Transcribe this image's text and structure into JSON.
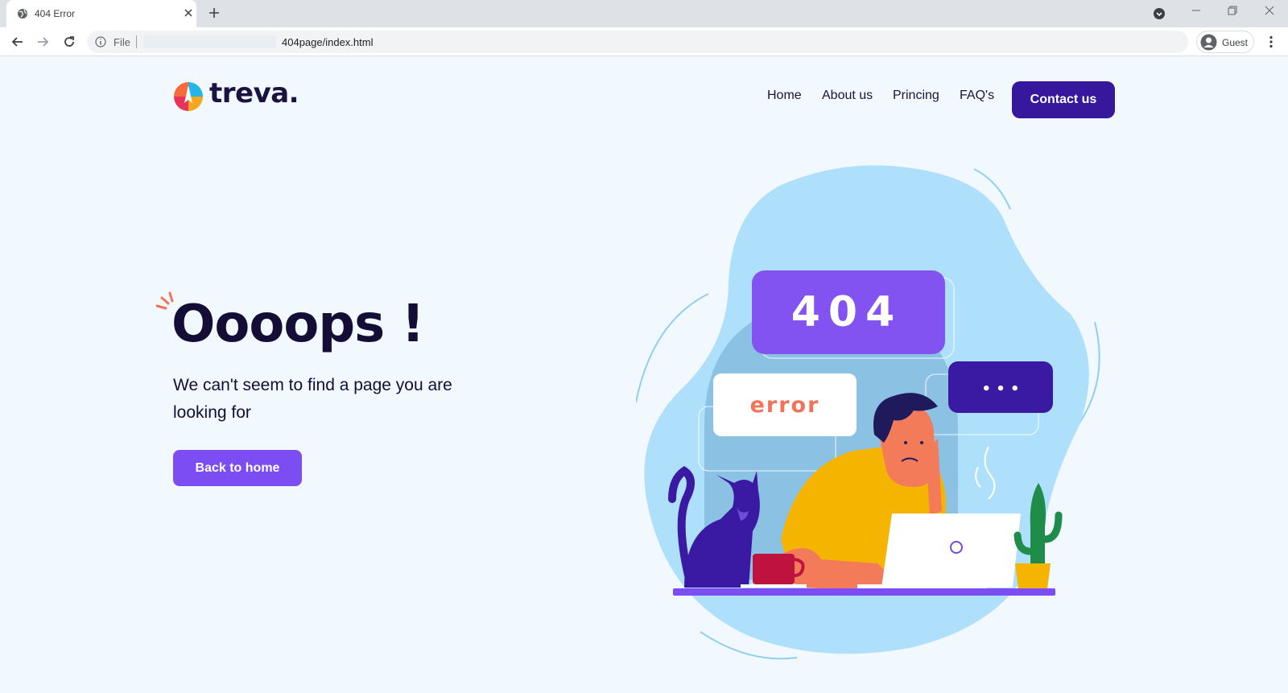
{
  "browser": {
    "tab": {
      "title": "404 Error"
    },
    "address": {
      "scheme": "File",
      "url": "404page/index.html"
    },
    "profile": {
      "label": "Guest"
    }
  },
  "site": {
    "logo_text": "treva.",
    "nav": [
      "Home",
      "About us",
      "Princing",
      "FAQ's"
    ],
    "contact_label": "Contact us"
  },
  "hero": {
    "heading": "Oooops !",
    "subtitle": "We can't seem to find a page you are looking for",
    "button_label": "Back to home"
  },
  "illustration": {
    "code_text": "404",
    "error_text": "error",
    "dots_text": "• • •"
  },
  "colors": {
    "page_bg": "#f1f8fe",
    "primary": "#7b4df2",
    "dark_button": "#35189b",
    "text_dark": "#140d36",
    "blob": "#aee0fb",
    "error_text": "#f0735a"
  }
}
